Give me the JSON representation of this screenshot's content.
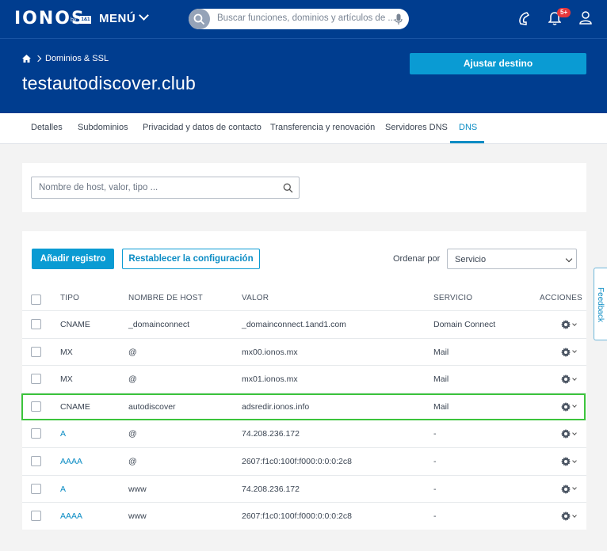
{
  "header": {
    "logo": "IONOS",
    "logo_by": "by",
    "logo_brand": "1&1",
    "menu_label": "MENÚ",
    "search_placeholder": "Buscar funciones, dominios y artículos de ...",
    "notifications_badge": "5+"
  },
  "hero": {
    "breadcrumb": "Dominios & SSL",
    "title": "testautodiscover.club",
    "action_label": "Ajustar destino"
  },
  "tabs": [
    {
      "label": "Detalles"
    },
    {
      "label": "Subdominios"
    },
    {
      "label": "Privacidad y datos de contacto"
    },
    {
      "label": "Transferencia y renovación"
    },
    {
      "label": "Servidores DNS"
    },
    {
      "label": "DNS",
      "active": true
    }
  ],
  "filter": {
    "placeholder": "Nombre de host, valor, tipo ..."
  },
  "records": {
    "add_label": "Añadir registro",
    "reset_label": "Restablecer la configuración",
    "sort_label": "Ordenar por",
    "sort_value": "Servicio",
    "columns": [
      "TIPO",
      "NOMBRE DE HOST",
      "VALOR",
      "SERVICIO",
      "ACCIONES"
    ],
    "rows": [
      {
        "type": "CNAME",
        "host": "_domainconnect",
        "value": "_domainconnect.1and1.com",
        "service": "Domain Connect",
        "link": false
      },
      {
        "type": "MX",
        "host": "@",
        "value": "mx00.ionos.mx",
        "service": "Mail",
        "link": false
      },
      {
        "type": "MX",
        "host": "@",
        "value": "mx01.ionos.mx",
        "service": "Mail",
        "link": false
      },
      {
        "type": "CNAME",
        "host": "autodiscover",
        "value": "adsredir.ionos.info",
        "service": "Mail",
        "link": false,
        "highlighted": true
      },
      {
        "type": "A",
        "host": "@",
        "value": "74.208.236.172",
        "service": "-",
        "link": true
      },
      {
        "type": "AAAA",
        "host": "@",
        "value": "2607:f1c0:100f:f000:0:0:0:2c8",
        "service": "-",
        "link": true
      },
      {
        "type": "A",
        "host": "www",
        "value": "74.208.236.172",
        "service": "-",
        "link": true
      },
      {
        "type": "AAAA",
        "host": "www",
        "value": "2607:f1c0:100f:f000:0:0:0:2c8",
        "service": "-",
        "link": true
      }
    ]
  },
  "feedback_label": "Feedback",
  "colors": {
    "brand": "#003d8f",
    "accent": "#0a9bd3",
    "highlight": "#3cc43c",
    "badge": "#e6373c"
  }
}
